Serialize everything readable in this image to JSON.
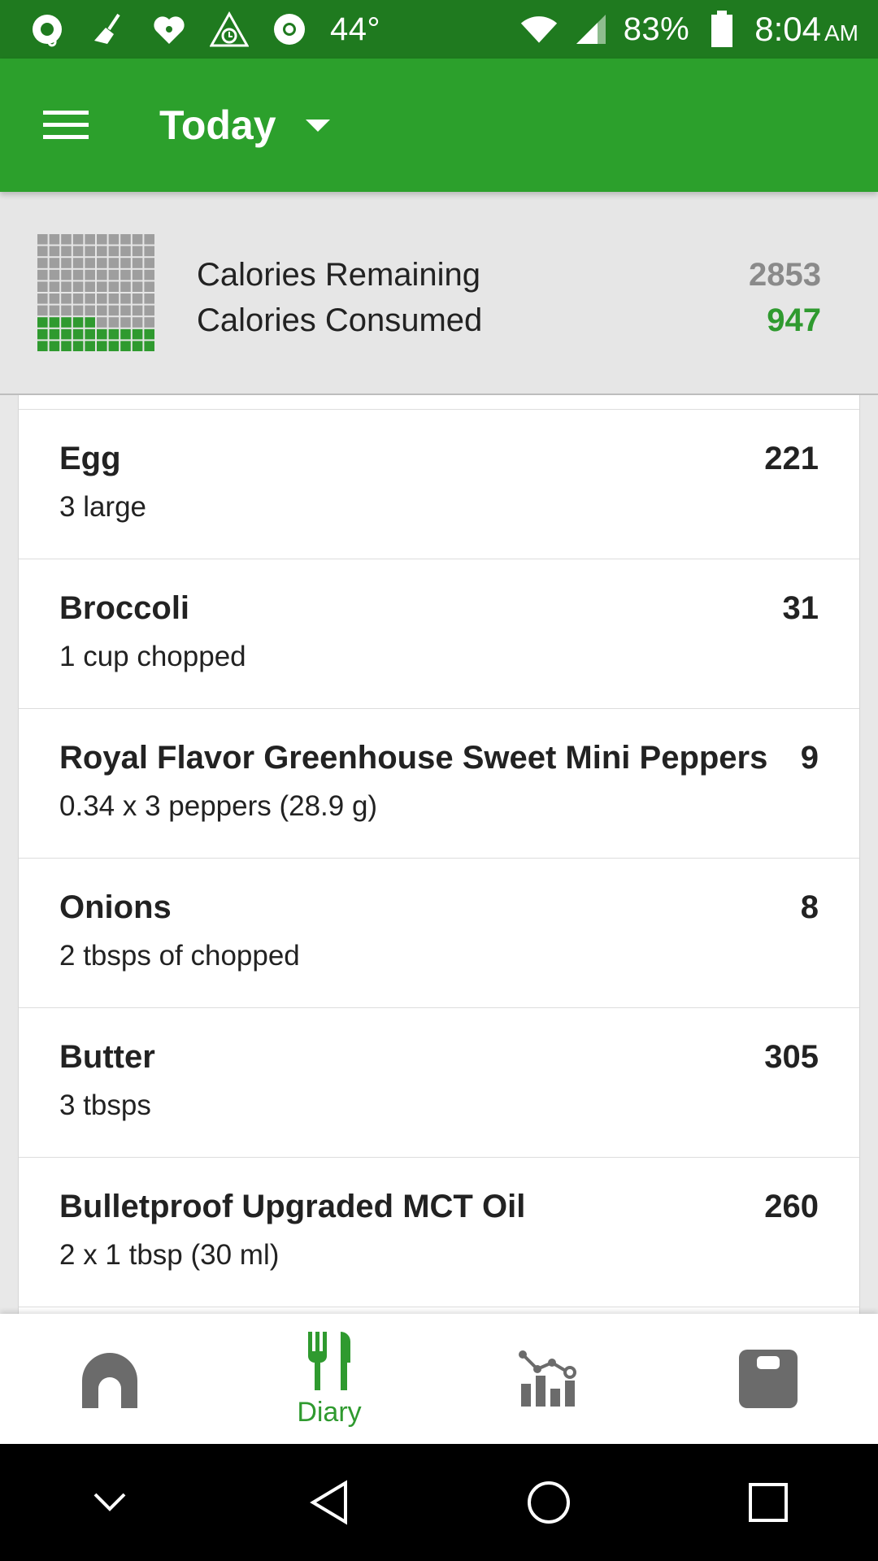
{
  "status_bar": {
    "temperature": "44°",
    "battery_percent": "83%",
    "time": "8:04",
    "am_pm": "AM",
    "icons": [
      "music-note-icon",
      "broom-icon",
      "iheart-radio-icon",
      "alarm-clock-icon",
      "chrome-icon",
      "wifi-icon",
      "signal-icon",
      "battery-icon"
    ]
  },
  "app_bar": {
    "title": "Today",
    "menu_icon": "hamburger-menu-icon",
    "dropdown_icon": "caret-down-icon",
    "color": "#2ca02c"
  },
  "summary": {
    "remaining_label": "Calories Remaining",
    "consumed_label": "Calories Consumed",
    "remaining_value": "2853",
    "consumed_value": "947",
    "consumed_fraction": 0.25,
    "remaining_color": "#8a8a8a",
    "consumed_color": "#2f9a2f"
  },
  "food_items": [
    {
      "name": "Egg",
      "serving": "3  large",
      "calories": "221"
    },
    {
      "name": "Broccoli",
      "serving": "1  cup chopped",
      "calories": "31"
    },
    {
      "name": "Royal Flavor Greenhouse Sweet Mini Peppers",
      "serving": "0.34 x 3 peppers (28.9 g)",
      "calories": "9"
    },
    {
      "name": "Onions",
      "serving": "2  tbsps of chopped",
      "calories": "8"
    },
    {
      "name": "Butter",
      "serving": "3  tbsps",
      "calories": "305"
    },
    {
      "name": "Bulletproof Upgraded MCT Oil",
      "serving": "2  x 1 tbsp (30 ml)",
      "calories": "260"
    }
  ],
  "bottom_nav": {
    "items": [
      {
        "icon": "home-icon",
        "label": ""
      },
      {
        "icon": "fork-knife-icon",
        "label": "Diary"
      },
      {
        "icon": "progress-chart-icon",
        "label": ""
      },
      {
        "icon": "scale-icon",
        "label": ""
      }
    ],
    "active_color": "#2f9a2f",
    "inactive_color": "#6b6b6b"
  },
  "system_nav": {
    "icons": [
      "collapse-chevron-icon",
      "back-icon",
      "home-circle-icon",
      "recents-square-icon"
    ]
  }
}
